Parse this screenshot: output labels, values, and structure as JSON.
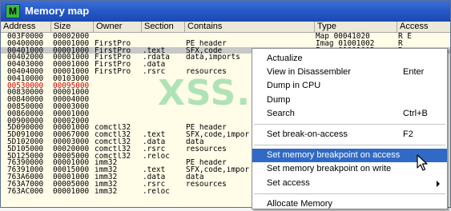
{
  "window": {
    "title": "Memory map",
    "icon_letter": "M",
    "icon": "ollydbg-app-icon"
  },
  "columns": [
    "Address",
    "Size",
    "Owner",
    "Section",
    "Contains",
    "Type",
    "Access"
  ],
  "rows": [
    [
      "003F0000",
      "00002000",
      "",
      "",
      "",
      "Map   00041020",
      "R E"
    ],
    [
      "00400000",
      "00001000",
      "FirstPro",
      "",
      "PE header",
      "Imag 01001002",
      "R"
    ],
    [
      "00401000",
      "00001000",
      "FirstPro",
      ".text",
      "SFX,code",
      "Imag 01001002",
      "R"
    ],
    [
      "00402000",
      "00001000",
      "FirstPro",
      ".rdata",
      "data,imports",
      "",
      ""
    ],
    [
      "00403000",
      "00001000",
      "FirstPro",
      ".data",
      "",
      "",
      ""
    ],
    [
      "00404000",
      "00001000",
      "FirstPro",
      ".rsrc",
      "resources",
      "",
      ""
    ],
    [
      "00410000",
      "00103000",
      "",
      "",
      "",
      "",
      ""
    ],
    [
      "00530000",
      "00095000",
      "",
      "",
      "",
      "",
      ""
    ],
    [
      "00830000",
      "00001000",
      "",
      "",
      "",
      "",
      ""
    ],
    [
      "00840000",
      "00004000",
      "",
      "",
      "",
      "",
      ""
    ],
    [
      "00850000",
      "00003000",
      "",
      "",
      "",
      "",
      ""
    ],
    [
      "00860000",
      "00001000",
      "",
      "",
      "",
      "",
      ""
    ],
    [
      "00900000",
      "00002000",
      "",
      "",
      "",
      "",
      ""
    ],
    [
      "5D090000",
      "00001000",
      "comctl32",
      "",
      "PE header",
      "",
      ""
    ],
    [
      "5D091000",
      "00067000",
      "comctl32",
      ".text",
      "SFX,code,impor",
      "",
      ""
    ],
    [
      "5D102000",
      "00003000",
      "comctl32",
      ".data",
      "data",
      "",
      ""
    ],
    [
      "5D105000",
      "00020000",
      "comctl32",
      ".rsrc",
      "resources",
      "",
      ""
    ],
    [
      "5D125000",
      "00005000",
      "comctl32",
      ".reloc",
      "",
      "",
      ""
    ],
    [
      "76390000",
      "00001000",
      "imm32",
      "",
      "PE header",
      "",
      ""
    ],
    [
      "76391000",
      "00015000",
      "imm32",
      ".text",
      "SFX,code,impor",
      "",
      ""
    ],
    [
      "763A6000",
      "00001000",
      "imm32",
      ".data",
      "data",
      "",
      ""
    ],
    [
      "763A7000",
      "00005000",
      "imm32",
      ".rsrc",
      "resources",
      "",
      ""
    ],
    [
      "763AC000",
      "00001000",
      "imm32",
      ".reloc",
      "",
      "",
      ""
    ]
  ],
  "selected_row": 2,
  "red_row": 7,
  "watermark": "XSS.is",
  "context_menu": [
    {
      "label": "Actualize",
      "shortcut": ""
    },
    {
      "label": "View in Disassembler",
      "shortcut": "Enter"
    },
    {
      "label": "Dump in CPU",
      "shortcut": ""
    },
    {
      "label": "Dump",
      "shortcut": ""
    },
    {
      "label": "Search",
      "shortcut": "Ctrl+B"
    },
    {
      "sep": true
    },
    {
      "label": "Set break-on-access",
      "shortcut": "F2"
    },
    {
      "sep": true
    },
    {
      "label": "Set memory breakpoint on access",
      "shortcut": "",
      "highlighted": true
    },
    {
      "label": "Set memory breakpoint on write",
      "shortcut": ""
    },
    {
      "label": "Set access",
      "shortcut": "",
      "submenu": true
    },
    {
      "sep": true
    },
    {
      "label": "Allocate Memory",
      "shortcut": ""
    }
  ],
  "colors": {
    "highlight": "#316ac5",
    "title_bar": "#2456c6",
    "list_bg": "#fffce8",
    "red_text": "#d00000"
  }
}
